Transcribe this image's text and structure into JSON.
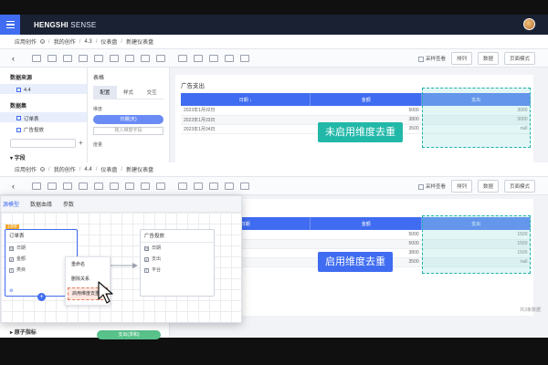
{
  "app": {
    "brand_bold": "HENGSHI",
    "brand_light": " SENSE",
    "accent": "#3f6cf0"
  },
  "breadcrumb_top": [
    "应用创作",
    "我的创作",
    "4.3",
    "仪表盘",
    "新建仪表盘"
  ],
  "breadcrumb_bottom": [
    "应用创作",
    "我的创作",
    "4.4",
    "仪表盘",
    "新建仪表盘"
  ],
  "toolbar": {
    "checkbox_label": "采样查看",
    "sort_label": "排列",
    "data_label": "数据",
    "page_label": "页面模式"
  },
  "left_panel": {
    "section_source": "数据来源",
    "source_item": "4.4",
    "section_dataset": "数据集",
    "datasets": [
      "订单表",
      "广告投放"
    ],
    "section_fields": "字段"
  },
  "mid_panel": {
    "title": "表格",
    "tabs": [
      "配置",
      "样式",
      "交互"
    ],
    "dimension_label": "维度",
    "dimension_value": "日期(天)",
    "dimension_add": "拖入维度字段",
    "measure_label": "度量"
  },
  "upper_chart": {
    "card_title": "广告支出",
    "headers": [
      "日期 ↓",
      "金额",
      "支出"
    ],
    "rows": [
      [
        "2023年1月02日",
        "5000",
        "3000"
      ],
      [
        "2023年1月03日",
        "3800",
        "3000"
      ],
      [
        "2023年1月04日",
        "3500",
        "null"
      ]
    ],
    "badge_text": "未启用维度去重",
    "badge_color": "#22b8a8"
  },
  "lower_chart": {
    "headers": [
      "日期",
      "金额",
      "支出"
    ],
    "rows": [
      [
        "",
        "5000",
        "1500"
      ],
      [
        "",
        "5000",
        "1500"
      ],
      [
        "",
        "3800",
        "1500"
      ],
      [
        "",
        "3500",
        "null"
      ]
    ],
    "badge_text": "启用维度去重",
    "badge_color": "#3f6cf0",
    "total_text": "共3条数据"
  },
  "model_panel": {
    "tabs": [
      "源模型",
      "数据血缘",
      "参数"
    ],
    "node_left": {
      "badge": "主数据",
      "title": "订单表",
      "fields": [
        {
          "type": "日",
          "name": "日期"
        },
        {
          "type": "#",
          "name": "金额"
        },
        {
          "type": "T",
          "name": "类目"
        }
      ]
    },
    "node_right": {
      "title": "广告投放",
      "fields": [
        {
          "type": "日",
          "name": "日期"
        },
        {
          "type": "#",
          "name": "支出"
        },
        {
          "type": "T",
          "name": "平台"
        }
      ]
    },
    "context_menu": [
      "重命名",
      "删除关系",
      "启用维度去重"
    ]
  },
  "lower_left": {
    "footer_item": "原子指标",
    "ok_button": "支出(求和)"
  }
}
